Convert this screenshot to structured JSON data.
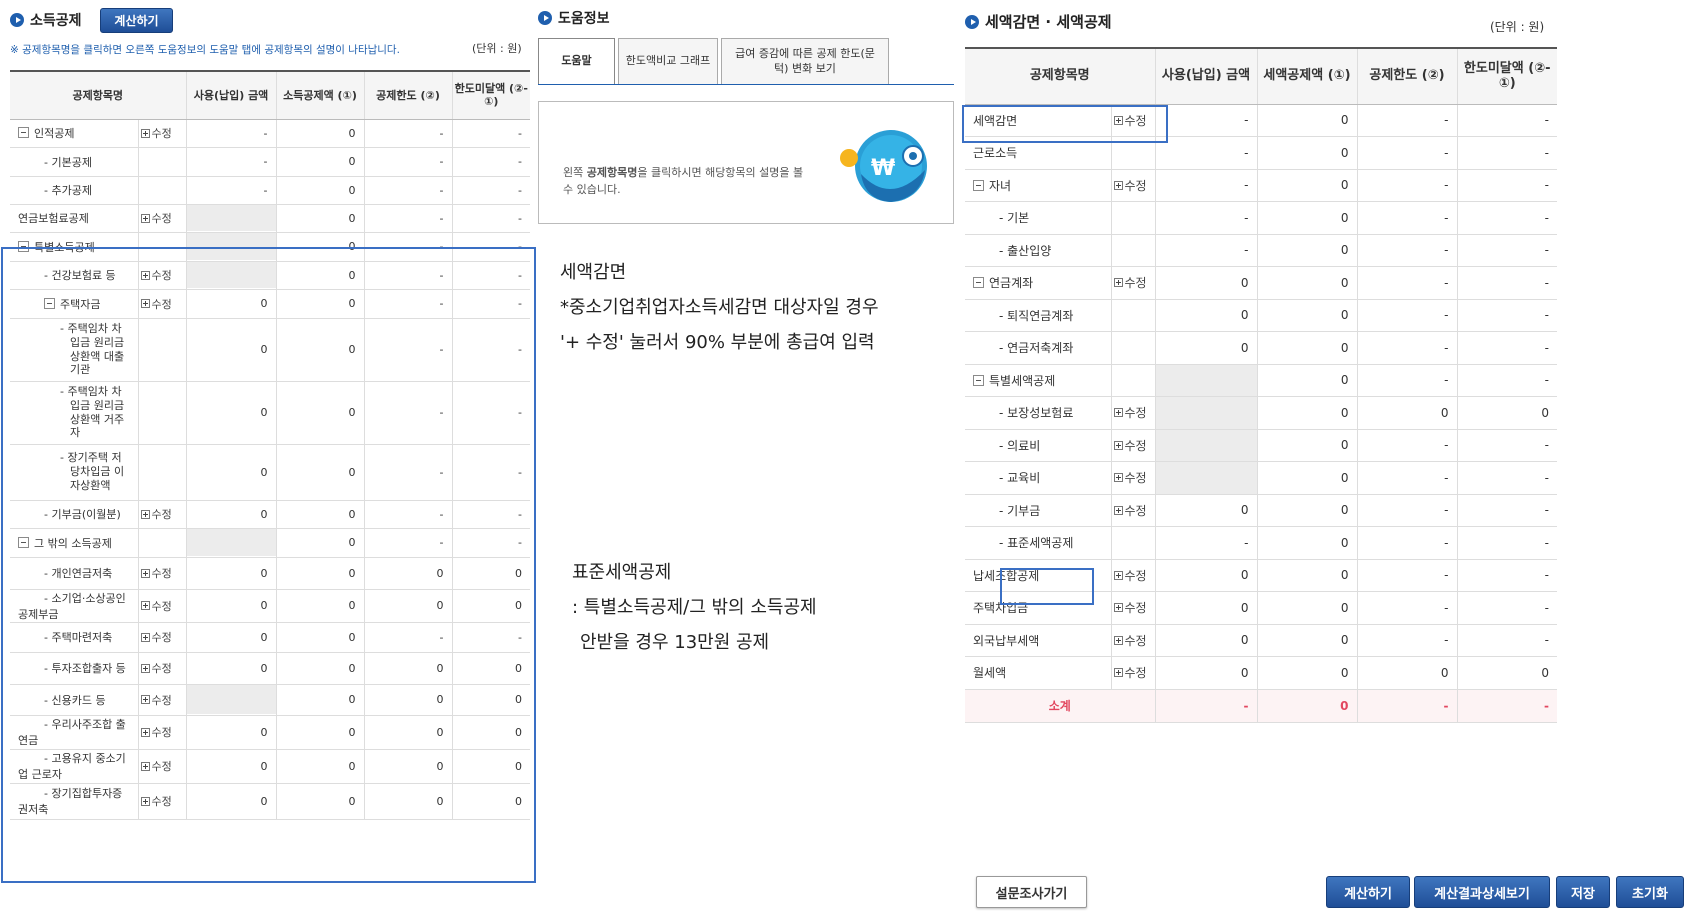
{
  "colors": {
    "accent": "#1f5fae",
    "subtotal": "#e2475f",
    "highlight": "#3a6fc4"
  },
  "income": {
    "title": "소득공제",
    "calc_button": "계산하기",
    "notice": "※ 공제항목명을 클릭하면 오른쪽 도움정보의 도움말 탭에 공제항목의 설명이 나타납니다.",
    "unit": "(단위 : 원)",
    "columns": [
      "공제항목명",
      "사용(납입) 금액",
      "소득공제액 (①)",
      "공제한도 (②)",
      "한도미달액 (②-①)"
    ],
    "edit_label": "수정",
    "rows": [
      {
        "name": "인적공제",
        "level": 0,
        "toggle": true,
        "edit": true,
        "used": "-",
        "deduct": "0",
        "limit": "-",
        "short": "-"
      },
      {
        "name": "- 기본공제",
        "level": 1,
        "edit": false,
        "used": "-",
        "deduct": "0",
        "limit": "-",
        "short": "-"
      },
      {
        "name": "- 추가공제",
        "level": 1,
        "edit": false,
        "used": "-",
        "deduct": "0",
        "limit": "-",
        "short": "-"
      },
      {
        "name": "연금보험료공제",
        "level": 0,
        "edit": true,
        "used": "",
        "blank": true,
        "deduct": "0",
        "limit": "-",
        "short": "-"
      },
      {
        "name": "특별소득공제",
        "level": 0,
        "toggle": true,
        "edit": false,
        "used": "",
        "blank": true,
        "deduct": "0",
        "limit": "-",
        "short": "-"
      },
      {
        "name": "- 건강보험료 등",
        "level": 1,
        "edit": true,
        "used": "",
        "blank": true,
        "deduct": "0",
        "limit": "-",
        "short": "-"
      },
      {
        "name": "주택자금",
        "level": 1,
        "toggle": true,
        "edit": true,
        "used": "0",
        "deduct": "0",
        "limit": "-",
        "short": "-"
      },
      {
        "name": "- 주택임차 차입금 원리금 상환액 대출기관",
        "level": 2,
        "edit": false,
        "used": "0",
        "deduct": "0",
        "limit": "-",
        "short": "-"
      },
      {
        "name": "- 주택임차 차입금 원리금 상환액 거주자",
        "level": 2,
        "edit": false,
        "used": "0",
        "deduct": "0",
        "limit": "-",
        "short": "-"
      },
      {
        "name": "- 장기주택 저당차입금 이자상환액",
        "level": 2,
        "edit": false,
        "used": "0",
        "deduct": "0",
        "limit": "-",
        "short": "-"
      },
      {
        "name": "- 기부금(이월분)",
        "level": 1,
        "edit": true,
        "used": "0",
        "deduct": "0",
        "limit": "-",
        "short": "-"
      },
      {
        "name": "그 밖의 소득공제",
        "level": 0,
        "toggle": true,
        "edit": false,
        "used": "",
        "blank": true,
        "deduct": "0",
        "limit": "-",
        "short": "-"
      },
      {
        "name": "- 개인연금저축",
        "level": 1,
        "edit": true,
        "used": "0",
        "deduct": "0",
        "limit": "0",
        "short": "0"
      },
      {
        "name": "- 소기업·소상공인 공제부금",
        "level": 1,
        "edit": true,
        "used": "0",
        "deduct": "0",
        "limit": "0",
        "short": "0"
      },
      {
        "name": "- 주택마련저축",
        "level": 1,
        "edit": true,
        "used": "0",
        "deduct": "0",
        "limit": "-",
        "short": "-"
      },
      {
        "name": "- 투자조합출자 등",
        "level": 1,
        "edit": true,
        "used": "0",
        "deduct": "0",
        "limit": "0",
        "short": "0"
      },
      {
        "name": "- 신용카드 등",
        "level": 1,
        "edit": true,
        "used": "",
        "blank": true,
        "deduct": "0",
        "limit": "0",
        "short": "0"
      },
      {
        "name": "- 우리사주조합 출연금",
        "level": 1,
        "edit": true,
        "used": "0",
        "deduct": "0",
        "limit": "0",
        "short": "0"
      },
      {
        "name": "- 고용유지 중소기업 근로자",
        "level": 1,
        "edit": true,
        "used": "0",
        "deduct": "0",
        "limit": "0",
        "short": "0"
      },
      {
        "name": "- 장기집합투자증권저축",
        "level": 1,
        "edit": true,
        "used": "0",
        "deduct": "0",
        "limit": "0",
        "short": "0"
      }
    ]
  },
  "help": {
    "title": "도움정보",
    "tabs": [
      "도움말",
      "한도액비교 그래프",
      "급여 증감에 따른 공제 한도(문턱) 변화 보기"
    ],
    "text_prefix": "왼쪽 ",
    "text_bold": "공제항목명",
    "text_suffix": "을 클릭하시면 해당항목의 설명을 볼 수 있습니다.",
    "mascot_symbol": "₩"
  },
  "notes": {
    "a": {
      "title": "세액감면",
      "line1": "*중소기업취업자소득세감면 대상자일 경우",
      "line2": "'+ 수정' 눌러서 90% 부분에 총급여 입력"
    },
    "b": {
      "title": "표준세액공제",
      "line1": ": 특별소득공제/그 밖의 소득공제",
      "line2": "안받을 경우 13만원 공제"
    }
  },
  "tax": {
    "title": "세액감면 · 세액공제",
    "unit": "(단위 : 원)",
    "columns": [
      "공제항목명",
      "사용(납입) 금액",
      "세액공제액 (①)",
      "공제한도 (②)",
      "한도미달액 (②-①)"
    ],
    "rows": [
      {
        "name": "세액감면",
        "level": 0,
        "edit": true,
        "used": "-",
        "deduct": "0",
        "limit": "-",
        "short": "-"
      },
      {
        "name": "근로소득",
        "level": 0,
        "edit": false,
        "used": "-",
        "deduct": "0",
        "limit": "-",
        "short": "-"
      },
      {
        "name": "자녀",
        "level": 0,
        "toggle": true,
        "edit": true,
        "used": "-",
        "deduct": "0",
        "limit": "-",
        "short": "-"
      },
      {
        "name": "- 기본",
        "level": 1,
        "edit": false,
        "used": "-",
        "deduct": "0",
        "limit": "-",
        "short": "-"
      },
      {
        "name": "- 출산입양",
        "level": 1,
        "edit": false,
        "used": "-",
        "deduct": "0",
        "limit": "-",
        "short": "-"
      },
      {
        "name": "연금계좌",
        "level": 0,
        "toggle": true,
        "edit": true,
        "used": "0",
        "deduct": "0",
        "limit": "-",
        "short": "-"
      },
      {
        "name": "- 퇴직연금계좌",
        "level": 1,
        "edit": false,
        "used": "0",
        "deduct": "0",
        "limit": "-",
        "short": "-"
      },
      {
        "name": "- 연금저축계좌",
        "level": 1,
        "edit": false,
        "used": "0",
        "deduct": "0",
        "limit": "-",
        "short": "-"
      },
      {
        "name": "특별세액공제",
        "level": 0,
        "toggle": true,
        "edit": false,
        "used": "",
        "blank": true,
        "deduct": "0",
        "limit": "-",
        "short": "-"
      },
      {
        "name": "- 보장성보험료",
        "level": 1,
        "edit": true,
        "used": "",
        "deduct": "0",
        "limit": "0",
        "short": "0"
      },
      {
        "name": "- 의료비",
        "level": 1,
        "edit": true,
        "used": "",
        "deduct": "0",
        "limit": "-",
        "short": "-"
      },
      {
        "name": "- 교육비",
        "level": 1,
        "edit": true,
        "used": "",
        "deduct": "0",
        "limit": "-",
        "short": "-"
      },
      {
        "name": "- 기부금",
        "level": 1,
        "edit": true,
        "used": "0",
        "deduct": "0",
        "limit": "-",
        "short": "-"
      },
      {
        "name": "- 표준세액공제",
        "level": 1,
        "edit": false,
        "used": "-",
        "deduct": "0",
        "limit": "-",
        "short": "-"
      },
      {
        "name": "납세조합공제",
        "level": 0,
        "edit": true,
        "used": "0",
        "deduct": "0",
        "limit": "-",
        "short": "-"
      },
      {
        "name": "주택차입금",
        "level": 0,
        "edit": true,
        "used": "0",
        "deduct": "0",
        "limit": "-",
        "short": "-"
      },
      {
        "name": "외국납부세액",
        "level": 0,
        "edit": true,
        "used": "0",
        "deduct": "0",
        "limit": "-",
        "short": "-"
      },
      {
        "name": "월세액",
        "level": 0,
        "edit": true,
        "used": "0",
        "deduct": "0",
        "limit": "0",
        "short": "0"
      }
    ],
    "subtotal": {
      "name": "소계",
      "used": "-",
      "deduct": "0",
      "limit": "-",
      "short": "-"
    }
  },
  "buttons": {
    "survey": "설문조사가기",
    "calc": "계산하기",
    "detail": "계산결과상세보기",
    "save": "저장",
    "reset": "초기화"
  }
}
